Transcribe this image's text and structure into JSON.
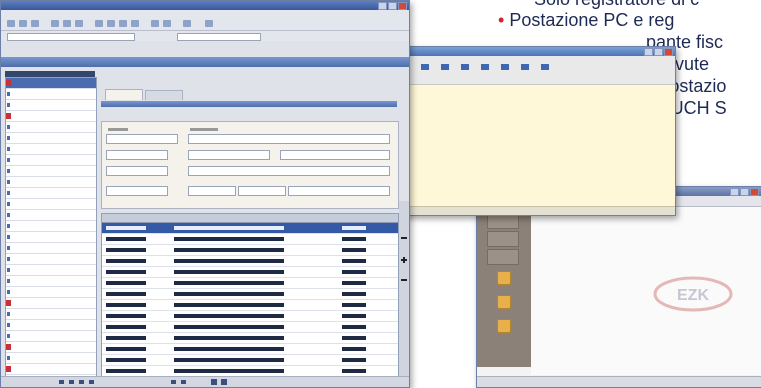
{
  "brochure": {
    "line1": "Solo registratore di c",
    "line2_bullet": "•",
    "line2": " Postazione PC e reg",
    "line3": "pante fisc",
    "line4": "ricevute",
    "line5_bullet": "•",
    "line5": " Postazio",
    "line6": "TOUCH S"
  },
  "logo_text": "EZK",
  "colors": {
    "accent_red": "#d4232b",
    "text_navy": "#1e2a55",
    "title_blue": "#4e6eab"
  }
}
